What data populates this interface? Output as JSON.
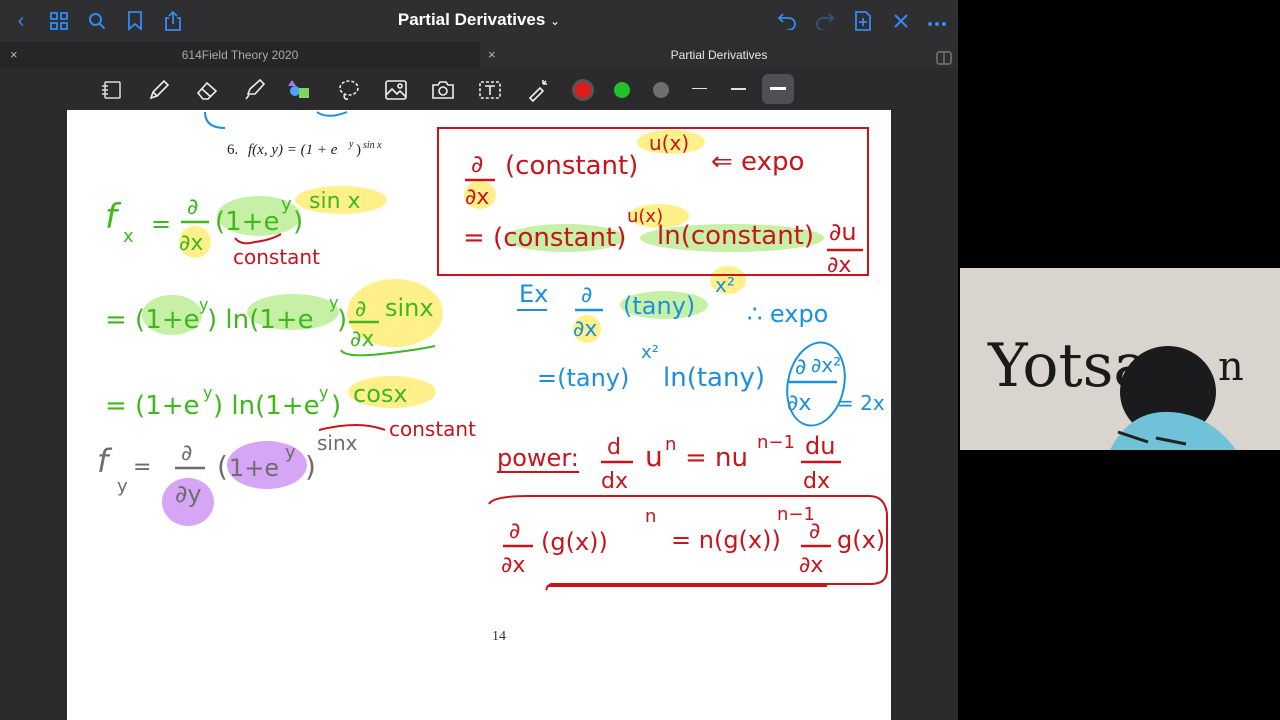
{
  "topbar": {
    "title": "Partial Derivatives",
    "title_chevron": "⌄"
  },
  "tabs": [
    {
      "label": "614Field Theory 2020"
    },
    {
      "label": "Partial Derivatives"
    }
  ],
  "toolbar": {
    "colors": {
      "red": "#e01b1b",
      "green": "#22c02a",
      "gray": "#7a7a7a"
    }
  },
  "document": {
    "problem_label": "6.",
    "problem_expr": "f(x, y) = (1 + e",
    "problem_sup_y": "y",
    "problem_close": ")",
    "problem_sup": "sin x",
    "page_number": "14"
  },
  "notes": {
    "fx_lhs": "f",
    "fx_sub": "x",
    "eq": "=",
    "partial": "∂",
    "dx": "∂x",
    "dy": "∂y",
    "base": "(1+e",
    "sup_y": "y",
    "rparen": ")",
    "sin_x": "sin x",
    "constant": "constant",
    "line2_pre": "= (1+e",
    "line2_mid": ") ln(1+e",
    "line2_end": ")",
    "sinx": "sinx",
    "line3_pre": "= (1+e",
    "line3_mid": ") ln(1+e",
    "line3_end": ")",
    "cosx": "cosx",
    "fy_lhs": "f",
    "fy_sub": "y",
    "fy_base": "1+e",
    "fy_sup": "sinx",
    "box_partial": "∂",
    "box_dx": "∂x",
    "box_const": "(constant)",
    "box_ux": "u(x)",
    "box_arrow": "⇐ expo",
    "box_line2": "= (constant)",
    "box_ln": "ln(constant)",
    "box_du": "∂u",
    "box_dx2": "∂x",
    "ex_label": "Ex",
    "ex_tany": "(tany)",
    "ex_x2": "x²",
    "ex_expo": "∴ expo",
    "ex_line2": "=(tany)",
    "ex_line2_sup": "x²",
    "ex_line2_ln": "ln(tany)",
    "ex_dx2": "∂x²",
    "ex_result": "= 2x",
    "power_label": "power:",
    "power_d": "d",
    "power_dx": "dx",
    "power_un": "u",
    "power_n": "n",
    "power_eq": "= nu",
    "power_n1": "n−1",
    "power_du": "du",
    "chain_open": "(g(x))",
    "chain_n": "n",
    "chain_eq": "= n(g(x))",
    "chain_n1": "n−1",
    "chain_gx": "g(x)"
  },
  "webcam": {
    "sign_text": "Yotsa",
    "sign_tail": "n"
  }
}
